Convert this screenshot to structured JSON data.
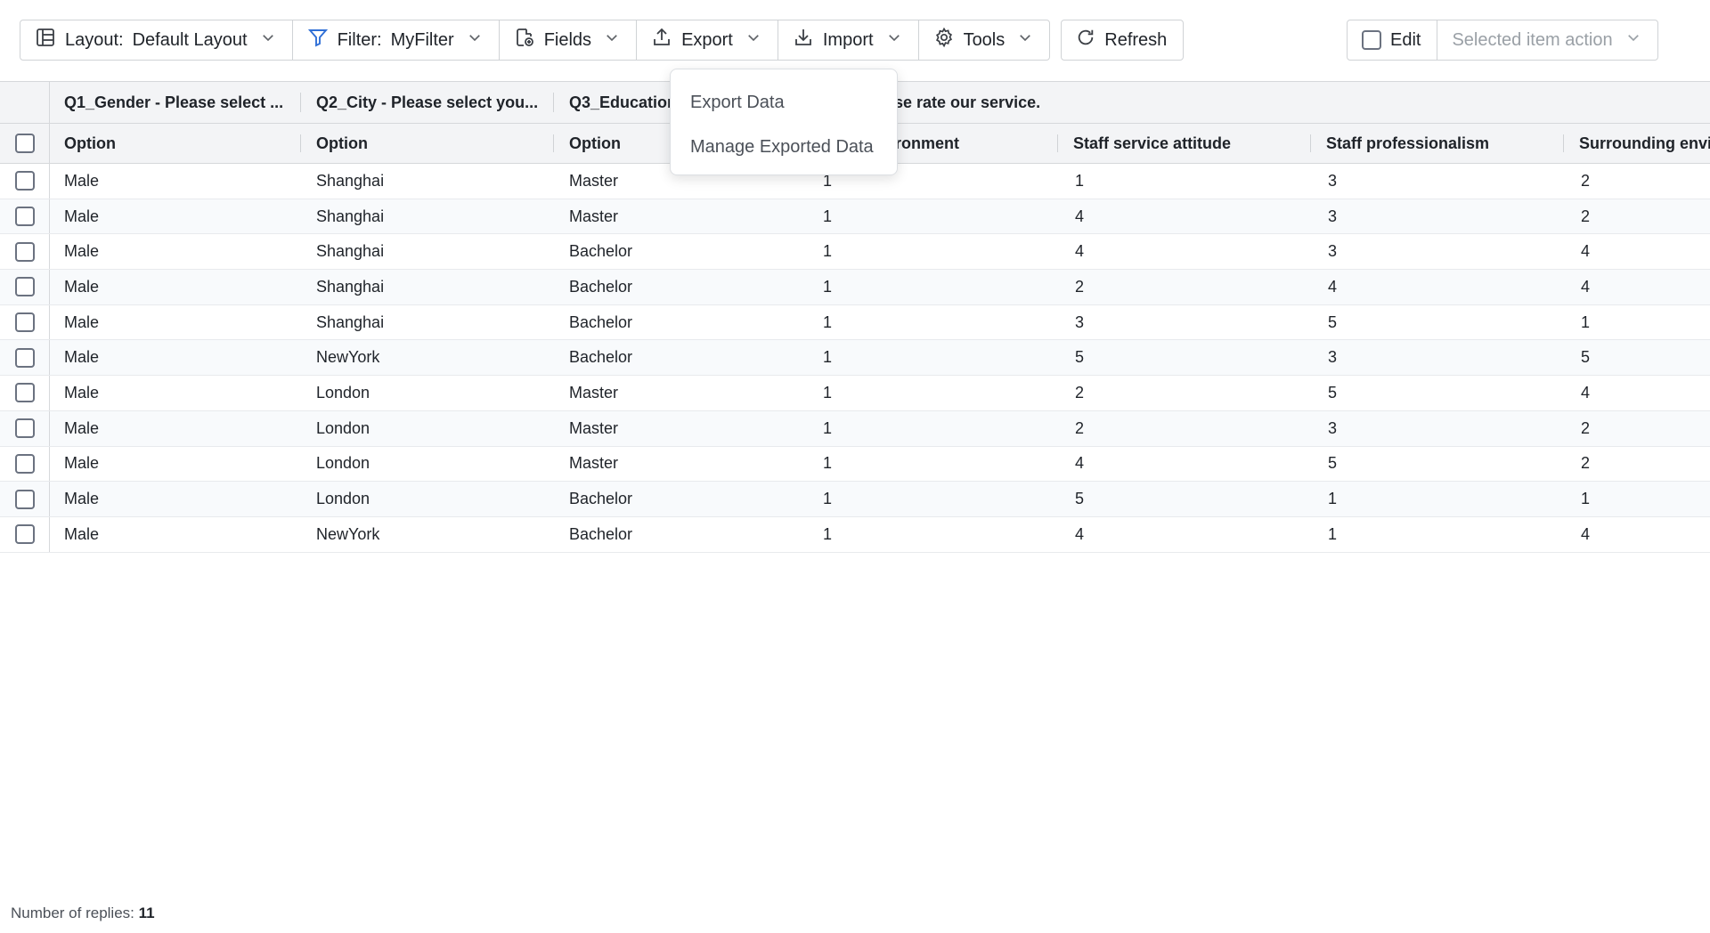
{
  "toolbar": {
    "layout_label": "Layout:",
    "layout_value": "Default Layout",
    "filter_label": "Filter:",
    "filter_value": "MyFilter",
    "fields_label": "Fields",
    "export_label": "Export",
    "import_label": "Import",
    "tools_label": "Tools",
    "refresh_label": "Refresh",
    "edit_label": "Edit",
    "selected_action_label": "Selected item action"
  },
  "export_menu": {
    "items": [
      "Export Data",
      "Manage Exported Data"
    ]
  },
  "grid": {
    "group_headers": [
      "Q1_Gender - Please select ...",
      "Q2_City - Please select you...",
      "Q3_Education",
      "se rate our service."
    ],
    "column_headers": [
      "Option",
      "Option",
      "Option",
      "ronment",
      "Staff service attitude",
      "Staff professionalism",
      "Surrounding envir"
    ],
    "rows": [
      [
        "Male",
        "Shanghai",
        "Master",
        "1",
        "1",
        "3",
        "2"
      ],
      [
        "Male",
        "Shanghai",
        "Master",
        "1",
        "4",
        "3",
        "2"
      ],
      [
        "Male",
        "Shanghai",
        "Bachelor",
        "1",
        "4",
        "3",
        "4"
      ],
      [
        "Male",
        "Shanghai",
        "Bachelor",
        "1",
        "2",
        "4",
        "4"
      ],
      [
        "Male",
        "Shanghai",
        "Bachelor",
        "1",
        "3",
        "5",
        "1"
      ],
      [
        "Male",
        "NewYork",
        "Bachelor",
        "1",
        "5",
        "3",
        "5"
      ],
      [
        "Male",
        "London",
        "Master",
        "1",
        "2",
        "5",
        "4"
      ],
      [
        "Male",
        "London",
        "Master",
        "1",
        "2",
        "3",
        "2"
      ],
      [
        "Male",
        "London",
        "Master",
        "1",
        "4",
        "5",
        "2"
      ],
      [
        "Male",
        "London",
        "Bachelor",
        "1",
        "5",
        "1",
        "1"
      ],
      [
        "Male",
        "NewYork",
        "Bachelor",
        "1",
        "4",
        "1",
        "4"
      ]
    ]
  },
  "footer": {
    "label": "Number of replies:",
    "count": "11"
  }
}
